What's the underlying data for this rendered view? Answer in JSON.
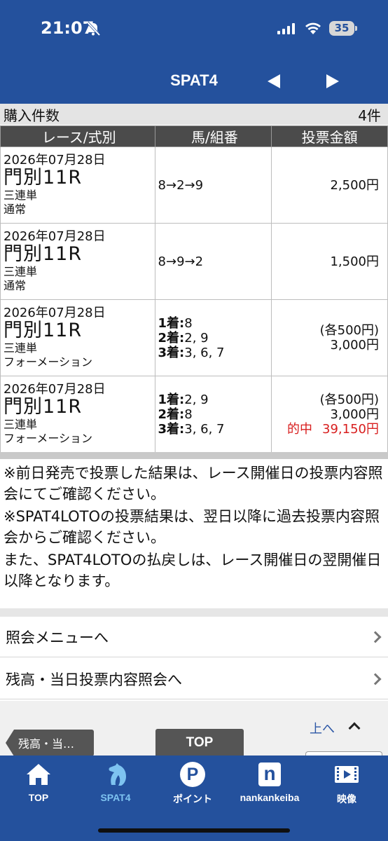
{
  "status_bar": {
    "time": "21:07",
    "battery": "35"
  },
  "nav": {
    "title": "SPAT4"
  },
  "summary": {
    "label": "購入件数",
    "count": "4件"
  },
  "table": {
    "headers": [
      "レース/式別",
      "馬/組番",
      "投票金額"
    ],
    "rows": [
      {
        "date": "2026年07月28日",
        "venue": "門別11R",
        "bet_type": "三連単",
        "method": "通常",
        "combo_lines": [
          {
            "label": "",
            "value": "8→2→9"
          }
        ],
        "amount_lines": [
          "2,500円"
        ],
        "hit": null
      },
      {
        "date": "2026年07月28日",
        "venue": "門別11R",
        "bet_type": "三連単",
        "method": "通常",
        "combo_lines": [
          {
            "label": "",
            "value": "8→9→2"
          }
        ],
        "amount_lines": [
          "1,500円"
        ],
        "hit": null
      },
      {
        "date": "2026年07月28日",
        "venue": "門別11R",
        "bet_type": "三連単",
        "method": "フォーメーション",
        "combo_lines": [
          {
            "label": "1着:",
            "value": "8"
          },
          {
            "label": "2着:",
            "value": "2, 9"
          },
          {
            "label": "3着:",
            "value": "3, 6, 7"
          }
        ],
        "amount_lines": [
          "(各500円)",
          "3,000円"
        ],
        "hit": null
      },
      {
        "date": "2026年07月28日",
        "venue": "門別11R",
        "bet_type": "三連単",
        "method": "フォーメーション",
        "combo_lines": [
          {
            "label": "1着:",
            "value": "2, 9"
          },
          {
            "label": "2着:",
            "value": "8"
          },
          {
            "label": "3着:",
            "value": "3, 6, 7"
          }
        ],
        "amount_lines": [
          "(各500円)",
          "3,000円"
        ],
        "hit": {
          "label": "的中",
          "value": "39,150円"
        }
      }
    ]
  },
  "notes": [
    "※前日発売で投票した結果は、レース開催日の投票内容照会にてご確認ください。",
    "※SPAT4LOTOの投票結果は、翌日以降に過去投票内容照会からご確認ください。",
    "また、SPAT4LOTOの払戻しは、レース開催日の翌開催日以降となります。"
  ],
  "menu": [
    {
      "label": "照会メニューへ"
    },
    {
      "label": "残高・当日投票内容照会へ"
    }
  ],
  "bottom_nav": {
    "back_label": "残高・当…",
    "top_label": "TOP",
    "up_label": "上へ"
  },
  "tabbar": [
    {
      "label": "TOP",
      "icon": "home-icon"
    },
    {
      "label": "SPAT4",
      "icon": "horse-icon"
    },
    {
      "label": "ポイント",
      "icon": "point-icon"
    },
    {
      "label": "nankankeiba",
      "icon": "n-logo-icon"
    },
    {
      "label": "映像",
      "icon": "video-icon"
    }
  ],
  "colors": {
    "primary": "#24519d",
    "hit_red": "#d81e1e",
    "active_tab": "#7ec3f0"
  }
}
